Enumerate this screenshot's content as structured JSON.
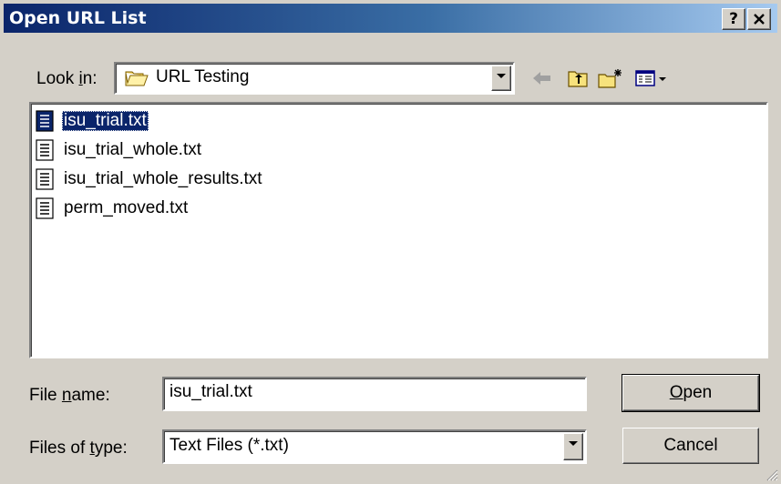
{
  "window": {
    "title": "Open URL List",
    "help_label": "?",
    "close_label": "✕"
  },
  "lookin": {
    "label_pre": "Look ",
    "label_key": "i",
    "label_post": "n:",
    "value": "URL Testing"
  },
  "toolbar": {
    "icons": [
      "back-arrow-icon",
      "up-folder-icon",
      "new-folder-icon",
      "view-menu-icon"
    ]
  },
  "files": [
    {
      "name": "isu_trial.txt",
      "selected": true
    },
    {
      "name": "isu_trial_whole.txt",
      "selected": false
    },
    {
      "name": "isu_trial_whole_results.txt",
      "selected": false
    },
    {
      "name": "perm_moved.txt",
      "selected": false
    }
  ],
  "filename": {
    "label_pre": "File ",
    "label_key": "n",
    "label_post": "ame:",
    "value": "isu_trial.txt"
  },
  "filetype": {
    "label_pre": "Files of ",
    "label_key": "t",
    "label_post": "ype:",
    "value": "Text Files (*.txt)"
  },
  "buttons": {
    "open_key": "O",
    "open_rest": "pen",
    "cancel": "Cancel"
  },
  "colors": {
    "title_start": "#0a246a",
    "title_end": "#a6caf0",
    "face": "#d4d0c8",
    "selection": "#0a246a"
  }
}
